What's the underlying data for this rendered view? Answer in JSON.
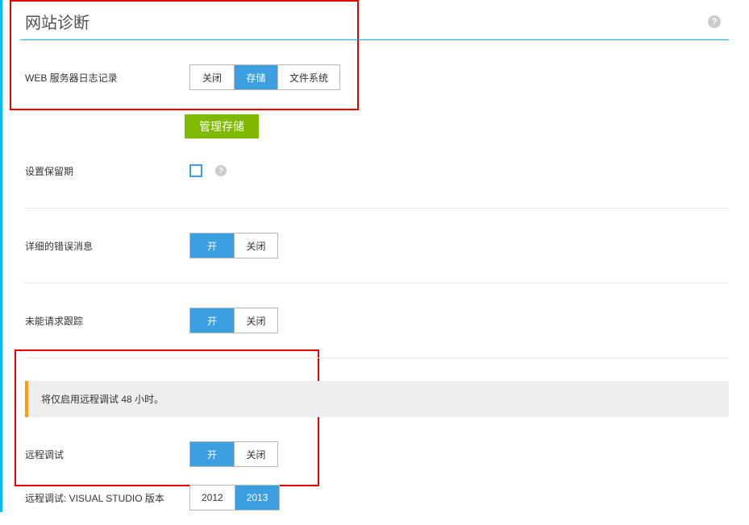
{
  "header": {
    "title": "网站诊断"
  },
  "labels": {
    "web_server_logging": "WEB 服务器日志记录",
    "set_retention": "设置保留期",
    "detailed_errors": "详细的错误消息",
    "failed_request_tracing": "未能请求跟踪",
    "remote_debugging": "远程调试",
    "remote_debug_vs_version": "远程调试: VISUAL STUDIO 版本"
  },
  "options": {
    "off": "关闭",
    "on": "开",
    "storage": "存储",
    "filesystem": "文件系统",
    "v2012": "2012",
    "v2013": "2013"
  },
  "buttons": {
    "manage_storage": "管理存储"
  },
  "notice": {
    "remote_debug_48h": "将仅启用远程调试 48 小时。"
  },
  "icons": {
    "help": "?"
  }
}
